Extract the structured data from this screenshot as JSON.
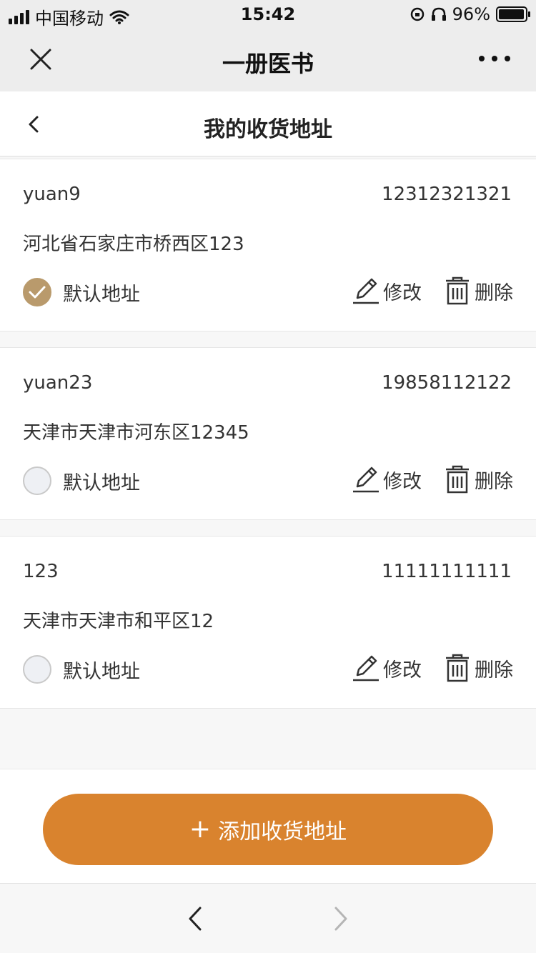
{
  "status_bar": {
    "carrier": "中国移动",
    "time": "15:42",
    "battery_percent": "96%",
    "battery_level": 0.96
  },
  "wechat_bar": {
    "title": "一册医书"
  },
  "header": {
    "title": "我的收货地址"
  },
  "addresses": [
    {
      "name": "yuan9",
      "phone": "12312321321",
      "address": "河北省石家庄市桥西区123",
      "is_default": true,
      "default_label": "默认地址",
      "edit_label": "修改",
      "delete_label": "删除"
    },
    {
      "name": "yuan23",
      "phone": "19858112122",
      "address": "天津市天津市河东区12345",
      "is_default": false,
      "default_label": "默认地址",
      "edit_label": "修改",
      "delete_label": "删除"
    },
    {
      "name": "123",
      "phone": "11111111111",
      "address": "天津市天津市和平区12",
      "is_default": false,
      "default_label": "默认地址",
      "edit_label": "修改",
      "delete_label": "删除"
    }
  ],
  "add_button": {
    "plus": "+",
    "label": "添加收货地址"
  },
  "colors": {
    "accent": "#d9832e",
    "checked": "#b99a6c"
  },
  "icons": [
    "close-icon",
    "more-icon",
    "back-icon",
    "check-icon",
    "edit-icon",
    "trash-icon",
    "nav-back-icon",
    "nav-forward-icon"
  ]
}
